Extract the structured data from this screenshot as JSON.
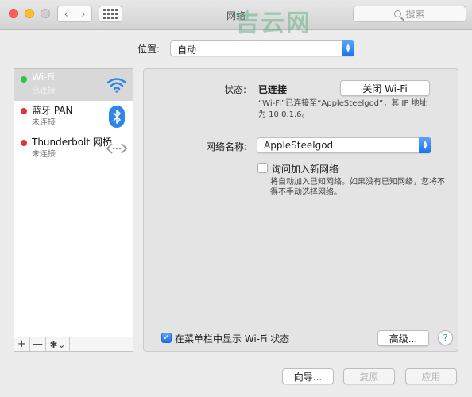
{
  "window": {
    "title": "网络",
    "watermark": "吉云网",
    "search_placeholder": "搜索"
  },
  "toolbar": {
    "back_glyph": "‹",
    "forward_glyph": "›"
  },
  "location": {
    "label": "位置:",
    "value": "自动"
  },
  "services": [
    {
      "name": "Wi-Fi",
      "status": "已连接",
      "dot_color": "#27c93f",
      "icon": "wifi-icon",
      "selected": true
    },
    {
      "name": "蓝牙 PAN",
      "status": "未连接",
      "dot_color": "#e0343a",
      "icon": "bluetooth-icon",
      "selected": false
    },
    {
      "name": "Thunderbolt 网桥",
      "status": "未连接",
      "dot_color": "#e0343a",
      "icon": "thunderbolt-bridge-icon",
      "selected": false
    }
  ],
  "sidebar_controls": {
    "add": "+",
    "remove": "—",
    "gear": "✱⌄"
  },
  "detail": {
    "status_label": "状态:",
    "status_value": "已连接",
    "toggle_wifi_button": "关闭 Wi-Fi",
    "status_desc_line1": "“Wi-Fi”已连接至“AppleSteelgod”，其 IP 地址",
    "status_desc_line2": "为 10.0.1.6。",
    "network_name_label": "网络名称:",
    "network_name_value": "AppleSteelgod",
    "ask_join_label": "询问加入新网络",
    "ask_join_checked": false,
    "ask_join_note_line1": "将自动加入已知网络。如果没有已知网络，您将不",
    "ask_join_note_line2": "得不手动选择网络。",
    "show_menubar_label": "在菜单栏中显示 Wi-Fi 状态",
    "show_menubar_checked": true,
    "advanced_button": "高级...",
    "help_glyph": "?"
  },
  "footer": {
    "assist_button": "向导...",
    "revert_button": "复原",
    "apply_button": "应用"
  },
  "colors": {
    "accent": "#1a74e8",
    "selection": "#d8d8d8",
    "connected": "#27c93f",
    "disconnected": "#e0343a"
  }
}
